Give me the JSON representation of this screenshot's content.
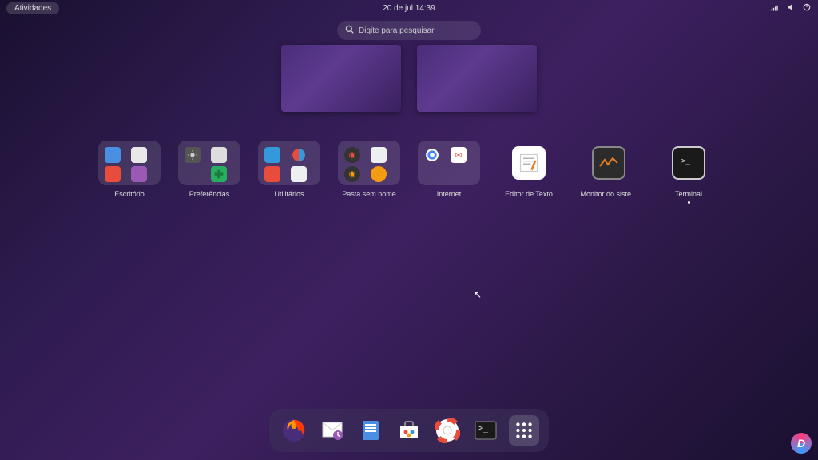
{
  "topbar": {
    "activities": "Atividades",
    "datetime": "20 de jul  14:39"
  },
  "search": {
    "placeholder": "Digite para pesquisar"
  },
  "apps": [
    {
      "label": "Escritório",
      "type": "folder"
    },
    {
      "label": "Preferências",
      "type": "folder"
    },
    {
      "label": "Utilitários",
      "type": "folder"
    },
    {
      "label": "Pasta sem nome",
      "type": "folder"
    },
    {
      "label": "Internet",
      "type": "folder"
    },
    {
      "label": "Editor de Texto",
      "type": "app"
    },
    {
      "label": "Monitor do siste...",
      "type": "app"
    },
    {
      "label": "Terminal",
      "type": "app",
      "running": true
    }
  ],
  "dock": {
    "items": [
      "firefox",
      "evolution",
      "files",
      "software",
      "help",
      "terminal",
      "apps-grid"
    ]
  },
  "colors": {
    "accent": "#5e3a8f",
    "folder_bg": "rgba(255,255,255,0.12)"
  }
}
